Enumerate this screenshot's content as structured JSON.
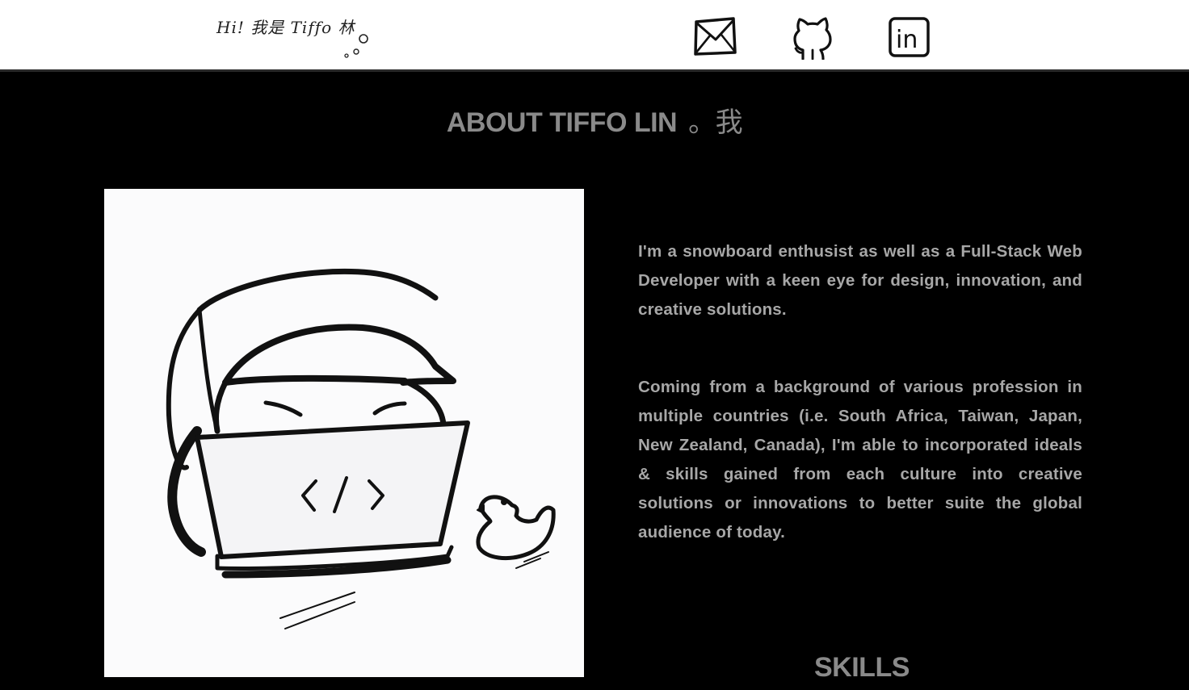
{
  "header": {
    "logo_text": "Hi! 我是 Tiffo 林",
    "social": [
      {
        "name": "email",
        "icon": "mail-icon"
      },
      {
        "name": "github",
        "icon": "github-icon"
      },
      {
        "name": "linkedin",
        "icon": "linkedin-icon",
        "label": "in"
      }
    ]
  },
  "about": {
    "title": "ABOUT TIFFO LIN",
    "title_suffix": "。我",
    "portrait_icon": "developer-illustration",
    "code_symbol": "</>",
    "paragraph_1": "I'm a snowboard enthusist as well as a Full-Stack Web Developer with a keen eye for design, innovation, and creative solutions.",
    "paragraph_2": "Coming from a background of various profession in multiple countries (i.e. South Africa, Taiwan, Japan, New Zealand, Canada), I'm able to incorporated ideals & skills gained from each culture into creative solutions or innovations to better suite the global audience of today."
  },
  "skills": {
    "title": "SKILLS"
  },
  "colors": {
    "header_bg": "#ffffff",
    "page_bg": "#000000",
    "title": "#8a8a8a",
    "body_text": "#a7a7a7"
  }
}
